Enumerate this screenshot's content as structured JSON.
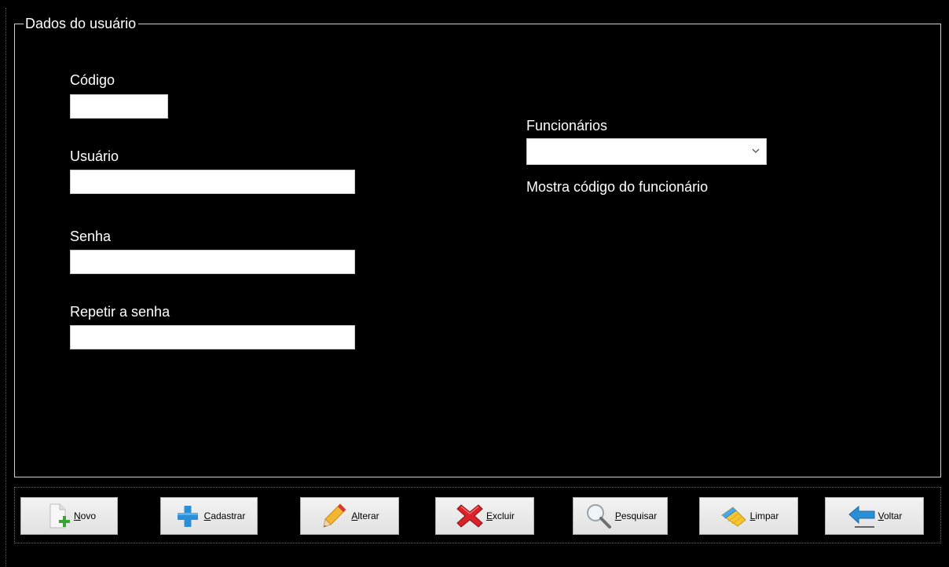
{
  "group": {
    "title": "Dados do usuário"
  },
  "fields": {
    "codigo": {
      "label": "Código",
      "value": ""
    },
    "usuario": {
      "label": "Usuário",
      "value": ""
    },
    "senha": {
      "label": "Senha",
      "value": ""
    },
    "repetir_senha": {
      "label": "Repetir a senha",
      "value": ""
    }
  },
  "funcionarios": {
    "label": "Funcionários",
    "selected": "",
    "codigo_label": "Mostra código do funcionário"
  },
  "buttons": [
    {
      "name": "novo",
      "mnemonic": "N",
      "rest": "ovo",
      "icon": "new-document-icon"
    },
    {
      "name": "cadastrar",
      "mnemonic": "C",
      "rest": "adastrar",
      "icon": "plus-icon"
    },
    {
      "name": "alterar",
      "mnemonic": "A",
      "rest": "lterar",
      "icon": "pencil-icon"
    },
    {
      "name": "excluir",
      "mnemonic": "E",
      "rest": "xcluir",
      "icon": "delete-x-icon"
    },
    {
      "name": "pesquisar",
      "mnemonic": "P",
      "rest": "esquisar",
      "icon": "magnifier-icon"
    },
    {
      "name": "limpar",
      "mnemonic": "L",
      "rest": "impar",
      "icon": "broom-icon"
    },
    {
      "name": "voltar",
      "mnemonic": "V",
      "rest": "oltar",
      "icon": "back-arrow-icon"
    }
  ],
  "colors": {
    "background": "#000000",
    "text": "#ffffff",
    "button_face": "#e6e6e6",
    "accent_blue": "#2b8fd6",
    "delete_red": "#d8232a"
  }
}
